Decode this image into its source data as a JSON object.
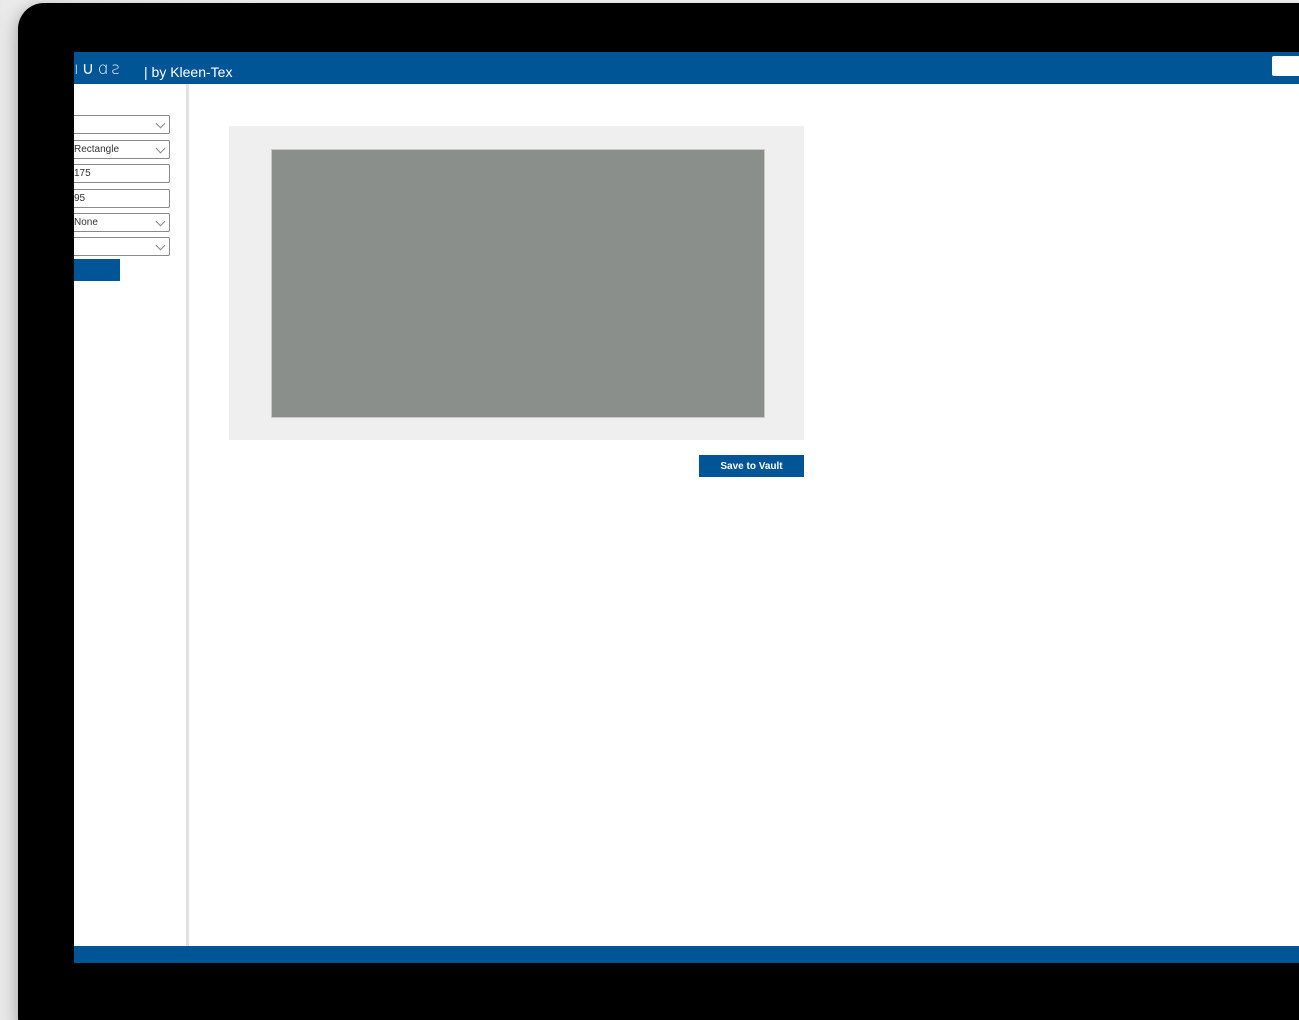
{
  "header": {
    "logo_text": "ı∪ɑƨ",
    "by_text": "| by Kleen-Tex"
  },
  "sidebar": {
    "fields": [
      {
        "value": "",
        "type": "select"
      },
      {
        "value": "Rectangle",
        "type": "select"
      },
      {
        "value": "175",
        "type": "input"
      },
      {
        "value": "95",
        "type": "input"
      },
      {
        "value": "None",
        "type": "select"
      },
      {
        "value": "",
        "type": "select"
      }
    ],
    "button_label": ""
  },
  "main": {
    "save_label": "Save to Vault"
  },
  "colors": {
    "brand_blue": "#005596",
    "canvas_bg": "#efefef",
    "shape_fill": "#8a8f8c"
  }
}
